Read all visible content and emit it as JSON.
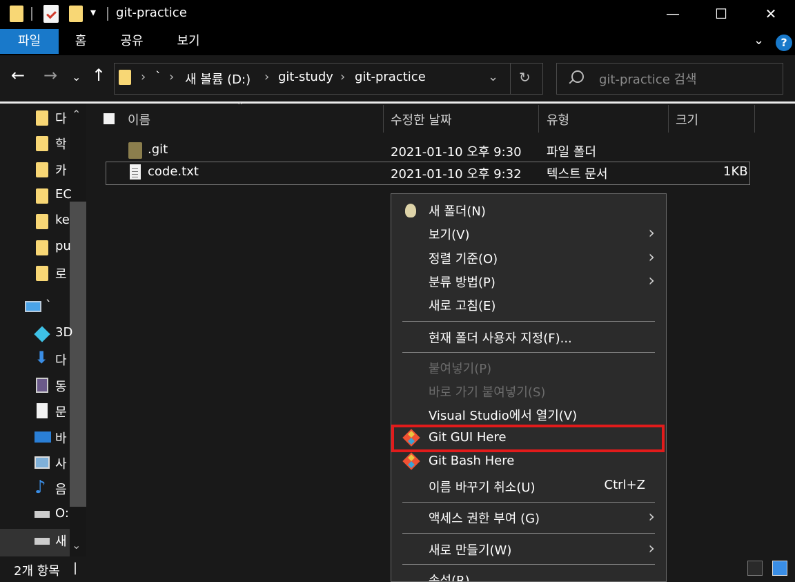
{
  "window": {
    "title": "git-practice",
    "controls": {
      "minimize": "—",
      "maximize": "☐",
      "close": "✕"
    }
  },
  "ribbon": {
    "tabs": [
      "파일",
      "홈",
      "공유",
      "보기"
    ],
    "active_tab": "파일",
    "help": "?"
  },
  "address": {
    "crumbs": [
      "`",
      "새 볼륨 (D:)",
      "git-study",
      "git-practice"
    ],
    "search_placeholder": "git-practice 검색"
  },
  "nav": {
    "items": [
      {
        "label": "다",
        "icon": "folder-icon"
      },
      {
        "label": "학",
        "icon": "folder-icon"
      },
      {
        "label": "카",
        "icon": "folder-icon"
      },
      {
        "label": "EC",
        "icon": "folder-icon"
      },
      {
        "label": "ke",
        "icon": "folder-icon"
      },
      {
        "label": "pu",
        "icon": "folder-icon"
      },
      {
        "label": "로",
        "icon": "folder-icon"
      },
      {
        "label": "`",
        "icon": "pc-icon"
      },
      {
        "label": "3D",
        "icon": "3d-objects-icon"
      },
      {
        "label": "다",
        "icon": "download-icon"
      },
      {
        "label": "동",
        "icon": "video-icon"
      },
      {
        "label": "문",
        "icon": "document-icon"
      },
      {
        "label": "바",
        "icon": "desktop-icon"
      },
      {
        "label": "사",
        "icon": "picture-icon"
      },
      {
        "label": "음",
        "icon": "music-icon"
      },
      {
        "label": "O:",
        "icon": "drive-icon"
      },
      {
        "label": "새",
        "icon": "drive-icon"
      }
    ]
  },
  "files": {
    "columns": [
      "이름",
      "수정한 날짜",
      "유형",
      "크기"
    ],
    "rows": [
      {
        "name": ".git",
        "modified": "2021-01-10 오후 9:30",
        "type": "파일 폴더",
        "size": ""
      },
      {
        "name": "code.txt",
        "modified": "2021-01-10 오후 9:32",
        "type": "텍스트 문서",
        "size": "1KB"
      }
    ]
  },
  "status": {
    "count": "2개 항목",
    "caret": "|"
  },
  "context_menu": {
    "items": [
      {
        "label": "새 폴더(N)",
        "icon": "new-folder-icon"
      },
      {
        "label": "보기(V)",
        "submenu": true
      },
      {
        "label": "정렬 기준(O)",
        "submenu": true
      },
      {
        "label": "분류 방법(P)",
        "submenu": true
      },
      {
        "label": "새로 고침(E)"
      },
      {
        "label": "현재 폴더 사용자 지정(F)..."
      },
      {
        "label": "붙여넣기(P)",
        "disabled": true
      },
      {
        "label": "바로 가기 붙여넣기(S)",
        "disabled": true
      },
      {
        "label": "Visual Studio에서 열기(V)"
      },
      {
        "label": "Git GUI Here",
        "icon": "git-icon",
        "highlighted": true
      },
      {
        "label": "Git Bash Here",
        "icon": "git-icon"
      },
      {
        "label": "이름 바꾸기 취소(U)",
        "shortcut": "Ctrl+Z"
      },
      {
        "label": "액세스 권한 부여 (G)",
        "submenu": true
      },
      {
        "label": "새로 만들기(W)",
        "submenu": true
      },
      {
        "label": "속성(R)"
      }
    ],
    "highlight_color": "#e21b1b"
  }
}
